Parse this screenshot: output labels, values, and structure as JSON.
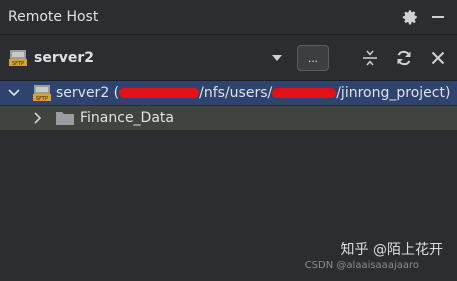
{
  "panel": {
    "title": "Remote Host",
    "icons": [
      "gear-icon",
      "minimize-icon"
    ]
  },
  "toolbar": {
    "server_name": "server2",
    "more_label": "...",
    "icons": [
      "sftp-icon",
      "chevron-down-icon",
      "collapse-icon",
      "refresh-icon",
      "close-icon"
    ]
  },
  "tree": {
    "root": {
      "label_server": "server2 (",
      "label_path_mid": "/nfs/users/",
      "label_path_end": "/jinrong_project)",
      "expanded": true
    },
    "children": [
      {
        "label": "Finance_Data",
        "expanded": false
      }
    ]
  },
  "watermark": {
    "primary": "知乎 @陌上花开",
    "secondary": "CSDN @alaaisaaajaaro"
  },
  "colors": {
    "background": "#2b2d30",
    "selected_row": "#2e436e",
    "child_row": "#40443f",
    "redaction": "#e3111a"
  }
}
